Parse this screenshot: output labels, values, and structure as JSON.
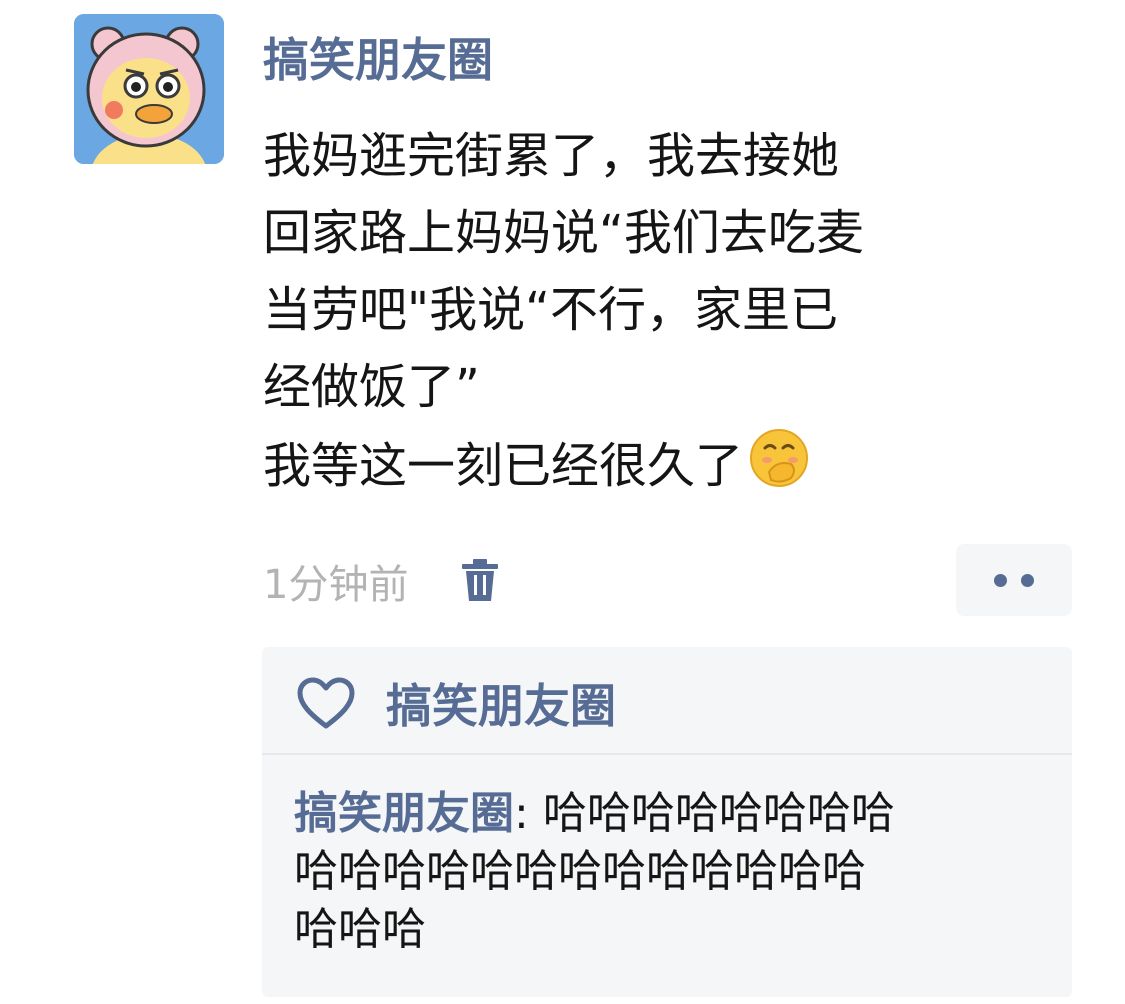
{
  "post": {
    "author": "搞笑朋友圈",
    "avatar_icon": "cartoon-duck-avatar",
    "text_lines": [
      "我妈逛完街累了，我去接她",
      "回家路上妈妈说“我们去吃麦",
      "当劳吧\"我说“不行，家里已",
      "经做饭了”",
      "我等这一刻已经很久了"
    ],
    "emoji_icon": "face-with-hand-over-mouth-emoji",
    "time": "1分钟前",
    "delete_icon": "trash-icon",
    "more_icon": "more-dots-icon"
  },
  "likes": {
    "icon": "heart-outline-icon",
    "names": "搞笑朋友圈"
  },
  "comments": [
    {
      "author": "搞笑朋友圈",
      "separator": ":",
      "text_lines": [
        "哈哈哈哈哈哈哈哈",
        "哈哈哈哈哈哈哈哈哈哈哈哈哈",
        "哈哈哈"
      ]
    }
  ],
  "colors": {
    "link": "#566c94",
    "text": "#151515",
    "muted": "#b3b3b3",
    "panel": "#f5f6f8"
  }
}
